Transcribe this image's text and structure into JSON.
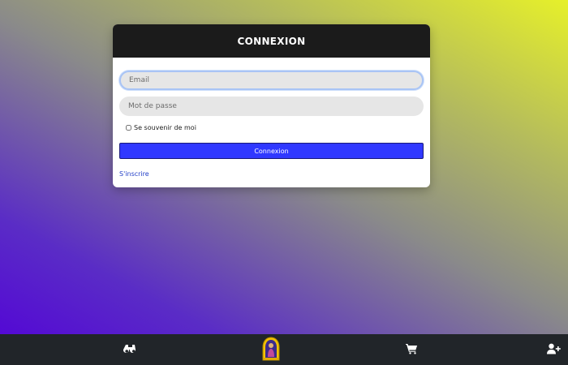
{
  "login": {
    "title": "CONNEXION",
    "email_placeholder": "Email",
    "password_placeholder": "Mot de passe",
    "remember_label": "Se souvenir de moi",
    "submit_label": "Connexion",
    "signup_link": "S'inscrire"
  },
  "bottom_nav": {
    "items": [
      {
        "icon": "binoculars-icon"
      },
      {
        "icon": "app-logo"
      },
      {
        "icon": "cart-icon"
      },
      {
        "icon": "user-plus-icon"
      }
    ]
  },
  "colors": {
    "header_bg": "#1b1b1b",
    "submit_bg": "#3038ff",
    "link": "#2440c8",
    "bottom_bar": "#212529"
  }
}
